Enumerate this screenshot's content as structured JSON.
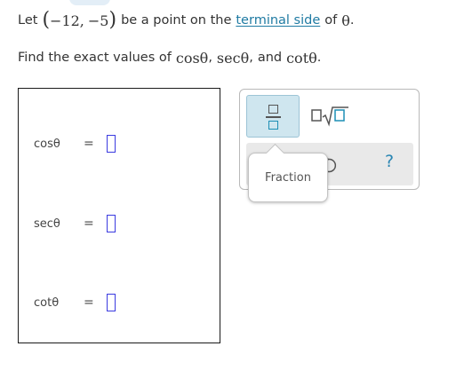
{
  "question": {
    "line1": {
      "let_text": "Let",
      "point_x": "−12",
      "point_sep": ",",
      "point_y": "−5",
      "mid_text": "be a point on the",
      "link_text": "terminal side",
      "of_text": "of",
      "theta": "θ",
      "end": "."
    },
    "line2": {
      "text": "Find the exact values of",
      "f1": "cosθ",
      "comma1": ",",
      "f2": "secθ",
      "comma2": ",",
      "and_text": "and",
      "f3": "cotθ",
      "end": "."
    }
  },
  "answers": [
    {
      "label": "cosθ",
      "eq": "=",
      "value": ""
    },
    {
      "label": "secθ",
      "eq": "=",
      "value": ""
    },
    {
      "label": "cotθ",
      "eq": "=",
      "value": ""
    }
  ],
  "palette": {
    "fraction_icon": "fraction-icon",
    "sqrt_icon": "square-root-icon",
    "undo_icon": "undo-icon",
    "help_label": "?",
    "tooltip_label": "Fraction"
  },
  "colors": {
    "link": "#207ba3",
    "input_border": "#3a3ae0",
    "selected_button": "#cfe6ef",
    "help": "#2a86b3"
  }
}
